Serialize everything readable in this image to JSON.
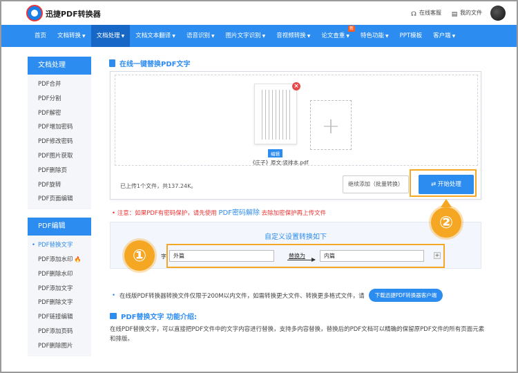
{
  "header": {
    "brand": "迅捷PDF转换器",
    "service_label": "在线客服",
    "my_files_label": "我的文件"
  },
  "nav": {
    "items": [
      {
        "label": "首页",
        "caret": false
      },
      {
        "label": "文档转换",
        "caret": true
      },
      {
        "label": "文档处理",
        "caret": true,
        "active": true
      },
      {
        "label": "文档文本翻译",
        "caret": true
      },
      {
        "label": "语音识别",
        "caret": true
      },
      {
        "label": "图片文字识别",
        "caret": true
      },
      {
        "label": "音视频转换",
        "caret": true
      },
      {
        "label": "论文查重",
        "caret": true,
        "badge": "新"
      },
      {
        "label": "特色功能",
        "caret": true
      },
      {
        "label": "PPT模板",
        "caret": false
      },
      {
        "label": "客户端",
        "caret": true
      }
    ]
  },
  "sidebar": {
    "section1_title": "文档处理",
    "section1_items": [
      "PDF合并",
      "PDF分割",
      "PDF解密",
      "PDF增加密码",
      "PDF修改密码",
      "PDF图片获取",
      "PDF删除页",
      "PDF旋转",
      "PDF页面编辑"
    ],
    "section2_title": "PDF编辑",
    "section2_items": [
      "PDF替换文字",
      "PDF添加水印",
      "PDF删除水印",
      "PDF添加文字",
      "PDF删除文字",
      "PDF链接编辑",
      "PDF添加页码",
      "PDF删除图片"
    ]
  },
  "main": {
    "title": "在线一键替换PDF文字",
    "file_edit_tag": "编辑",
    "file_name": "《庄子》原文:竖排本.pdf",
    "upload_info": "已上传1个文件，共137.24K。",
    "continue_button": "继续添加（批量转换）",
    "start_button": "开始处理",
    "notice_prefix": "注意：如果PDF有密码保护，请先使用",
    "notice_link": "PDF密码解除",
    "notice_suffix": "去除加密保护再上传文件",
    "custom_title": "自定义设置转换如下",
    "field_label_fragment": "字",
    "find_value": "外篇",
    "replace_label": "替换为",
    "replace_value": "内篇",
    "plus": "+",
    "info_line": "在线版PDF转换器转换文件仅限于200M以内文件，如需转换更大文件、转换更多格式文件，请",
    "download_button": "下载迅捷PDF转换器客户端",
    "intro_title": "PDF替换文字 功能介绍:",
    "intro_text": "在线PDF替换文字，可以直接把PDF文件中的文字内容进行替换，支持多内容替换，替换后的PDF文档可以精确的保留原PDF文件的所有页面元素和排版。"
  },
  "annotations": {
    "step1": "①",
    "step2": "②"
  }
}
